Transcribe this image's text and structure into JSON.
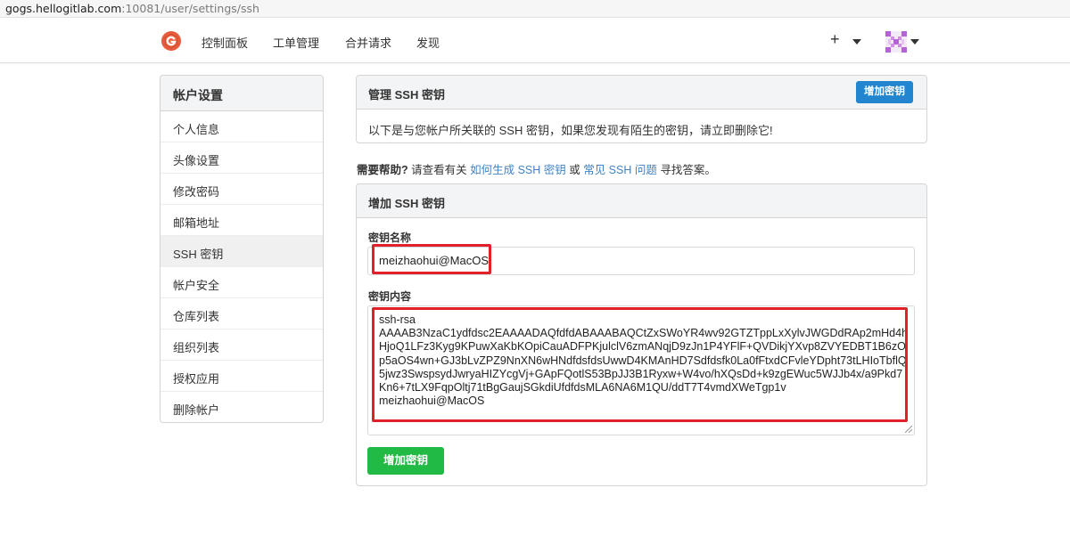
{
  "browser": {
    "url_host": "gogs.hellogitlab.com",
    "url_path": ":10081/user/settings/ssh"
  },
  "nav": {
    "items": [
      "控制面板",
      "工单管理",
      "合并请求",
      "发现"
    ],
    "plus_icon": "plus-icon",
    "logo_icon": "gogs-logo-icon",
    "avatar_icon": "identicon-avatar"
  },
  "sidebar": {
    "title": "帐户设置",
    "items": [
      "个人信息",
      "头像设置",
      "修改密码",
      "邮箱地址",
      "SSH 密钥",
      "帐户安全",
      "仓库列表",
      "组织列表",
      "授权应用",
      "删除帐户"
    ],
    "active_index": 4
  },
  "manage": {
    "title": "管理 SSH 密钥",
    "add_button": "增加密钥",
    "message": "以下是与您帐户所关联的 SSH 密钥，如果您发现有陌生的密钥，请立即删除它!"
  },
  "help": {
    "label": "需要帮助?",
    "pre": " 请查看有关 ",
    "link1": "如何生成 SSH 密钥",
    "mid": " 或 ",
    "link2": "常见 SSH 问题",
    "post": " 寻找答案。"
  },
  "add": {
    "title": "增加 SSH 密钥",
    "name_label": "密钥名称",
    "name_value": "meizhaohui@MacOS",
    "content_label": "密钥内容",
    "content_value": "ssh-rsa\nAAAAB3NzaC1ydfdsc2EAAAADAQfdfdABAAABAQCtZxSWoYR4wv92GTZTppLxXylvJWGDdRAp2mHd4hHjoQ1LFz3Kyg9KPuwXaKbKOpiCauADFPKjulclV6zmANqjD9zJn1P4YFlF+QVDikjYXvp8ZVYEDBT1B6zOp5aOS4wn+GJ3bLvZPZ9NnXN6wHNdfdsfdsUwwD4KMAnHD7Sdfdsfk0La0fFtxdCFvleYDpht73tLHIoTbflQ5jwz3SwspsydJwryaHIZYcgVj+GApFQotlS53BpJJ3B1Ryxw+W4vo/hXQsDd+k9zgEWuc5WJJb4x/a9Pkd7Kn6+7tLX9FqpOltj71tBgGaujSGkdiUfdfdsMLA6NA6M1QU/ddT7T4vmdXWeTgp1v\nmeizhaohui@MacOS",
    "submit_button": "增加密钥"
  },
  "colors": {
    "primary": "#2185d0",
    "success": "#21ba45",
    "highlight": "#e0202a",
    "link": "#4183c4"
  }
}
